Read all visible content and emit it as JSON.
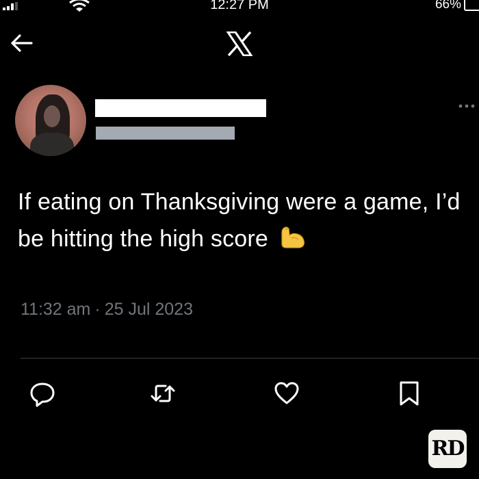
{
  "status_bar": {
    "time": "12:27 PM",
    "battery_percent": "66%",
    "icons": [
      "signal-icon",
      "wifi-icon",
      "battery-icon"
    ]
  },
  "nav": {
    "back_icon": "back-arrow-icon",
    "logo_icon": "x-logo-icon"
  },
  "tweet": {
    "text": "If eating on Thanksgiving were a game, I’d be hitting the high score",
    "emoji_icon": "flexed-biceps-icon",
    "time": "11:32 am",
    "separator": "·",
    "date": "25 Jul 2023"
  },
  "actions": {
    "icons": [
      "reply-icon",
      "retweet-icon",
      "like-icon",
      "bookmark-icon"
    ]
  },
  "watermark": {
    "label": "RD"
  },
  "colors": {
    "background": "#000000",
    "text": "#ffffff",
    "muted": "#71767b",
    "handle_redaction": "#a4aab2",
    "divider": "#3a3d42"
  }
}
